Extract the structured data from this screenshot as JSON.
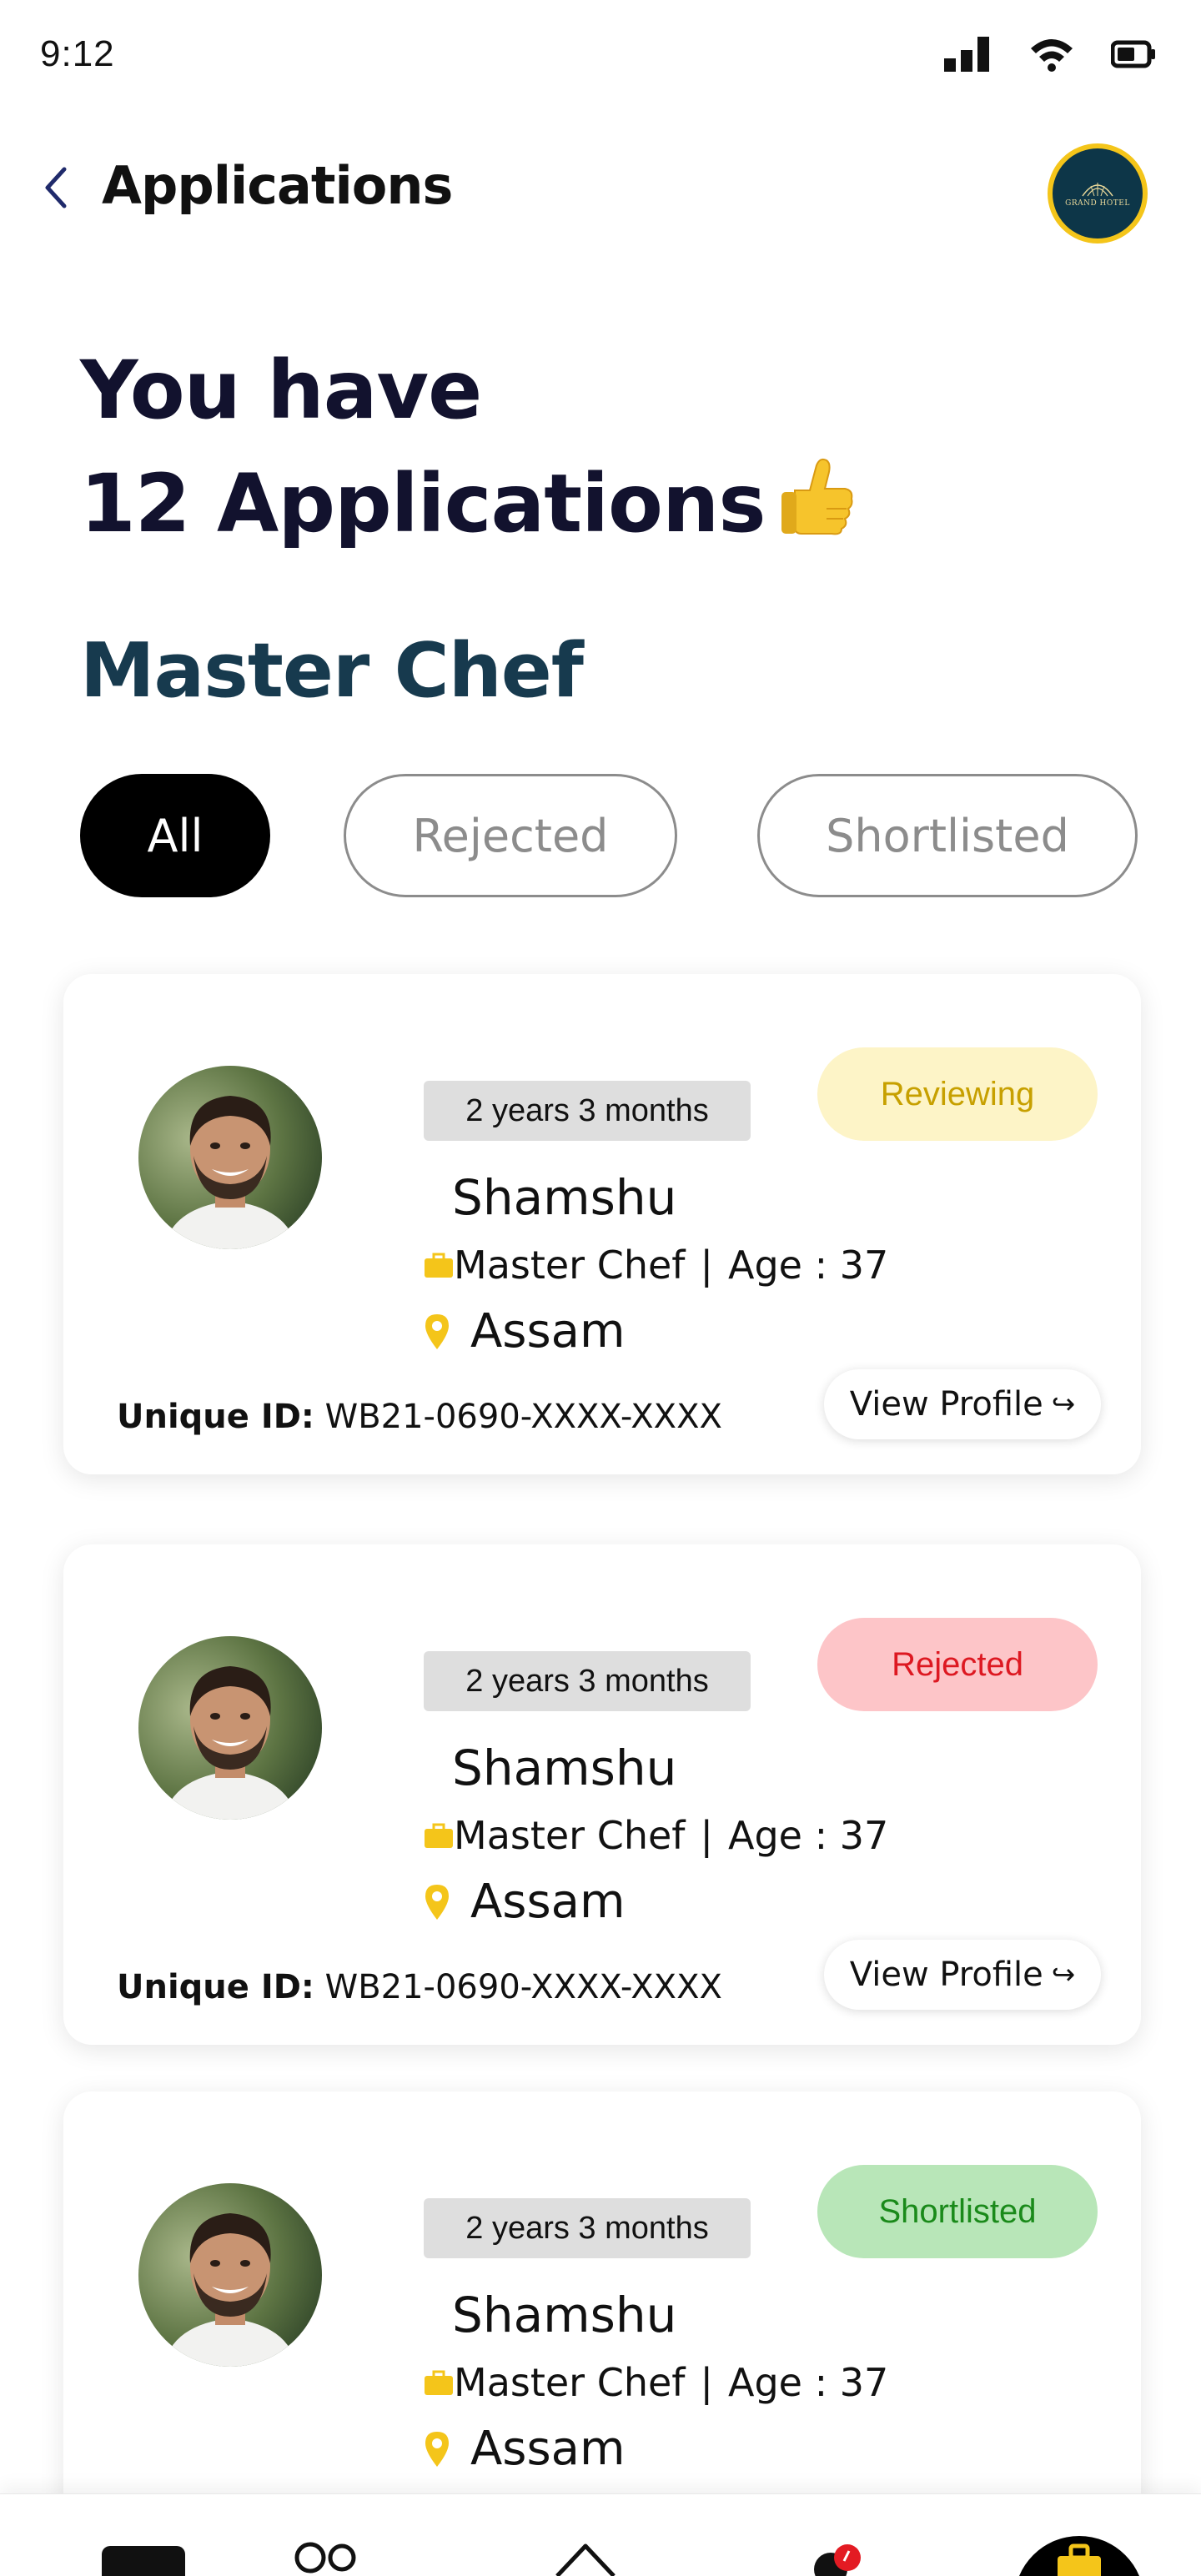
{
  "status_bar": {
    "time": "9:12"
  },
  "header": {
    "title": "Applications",
    "logo_text": "GRAND HOTEL"
  },
  "hero": {
    "line1": "You have",
    "line2": "12 Applications"
  },
  "job_title": "Master Chef",
  "filters": [
    {
      "label": "All",
      "active": true
    },
    {
      "label": "Rejected",
      "active": false
    },
    {
      "label": "Shortlisted",
      "active": false
    }
  ],
  "applications": [
    {
      "experience": "2 years 3 months",
      "status": "Reviewing",
      "name": "Shamshu",
      "role": "Master Chef",
      "separator": "|",
      "age": "Age : 37",
      "location": "Assam",
      "uid_label": "Unique ID:",
      "uid_value": "WB21-0690-XXXX-XXXX",
      "view_label": "View Profile",
      "status_color": "#c7a000"
    },
    {
      "experience": "2 years 3 months",
      "status": "Rejected",
      "name": "Shamshu",
      "role": "Master Chef",
      "separator": "|",
      "age": "Age : 37",
      "location": "Assam",
      "uid_label": "Unique ID:",
      "uid_value": "WB21-0690-XXXX-XXXX",
      "view_label": "View Profile",
      "status_color": "#dd1821"
    },
    {
      "experience": "2 years 3 months",
      "status": "Shortlisted",
      "name": "Shamshu",
      "role": "Master Chef",
      "separator": "|",
      "age": "Age : 37",
      "location": "Assam",
      "status_color": "#1a8a1a"
    }
  ],
  "icons": {
    "back": "chevron-left-icon",
    "thumb": "thumbs-up-icon",
    "briefcase": "briefcase-icon",
    "pin": "location-pin-icon"
  },
  "colors": {
    "accent": "#f4c51a",
    "hero_text": "#12122e",
    "job_title": "#173a4e"
  }
}
